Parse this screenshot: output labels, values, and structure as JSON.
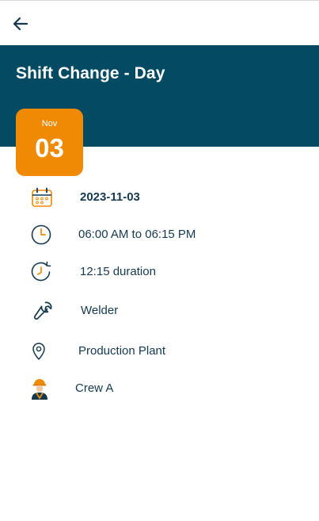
{
  "header": {
    "title": "Shift Change - Day"
  },
  "date_badge": {
    "month": "Nov",
    "day": "03"
  },
  "details": {
    "date": "2023-11-03",
    "time_range": "06:00 AM to 06:15 PM",
    "duration": "12:15 duration",
    "role": "Welder",
    "location": "Production Plant",
    "crew": "Crew A"
  },
  "colors": {
    "header_bg": "#044a63",
    "badge_bg": "#f08a05",
    "text": "#14394f"
  },
  "icons": {
    "back": "arrow-left-icon",
    "date": "calendar-icon",
    "time": "clock-icon",
    "duration": "clock-refresh-icon",
    "role": "wrench-icon",
    "location": "map-pin-icon",
    "crew": "worker-avatar-icon"
  }
}
